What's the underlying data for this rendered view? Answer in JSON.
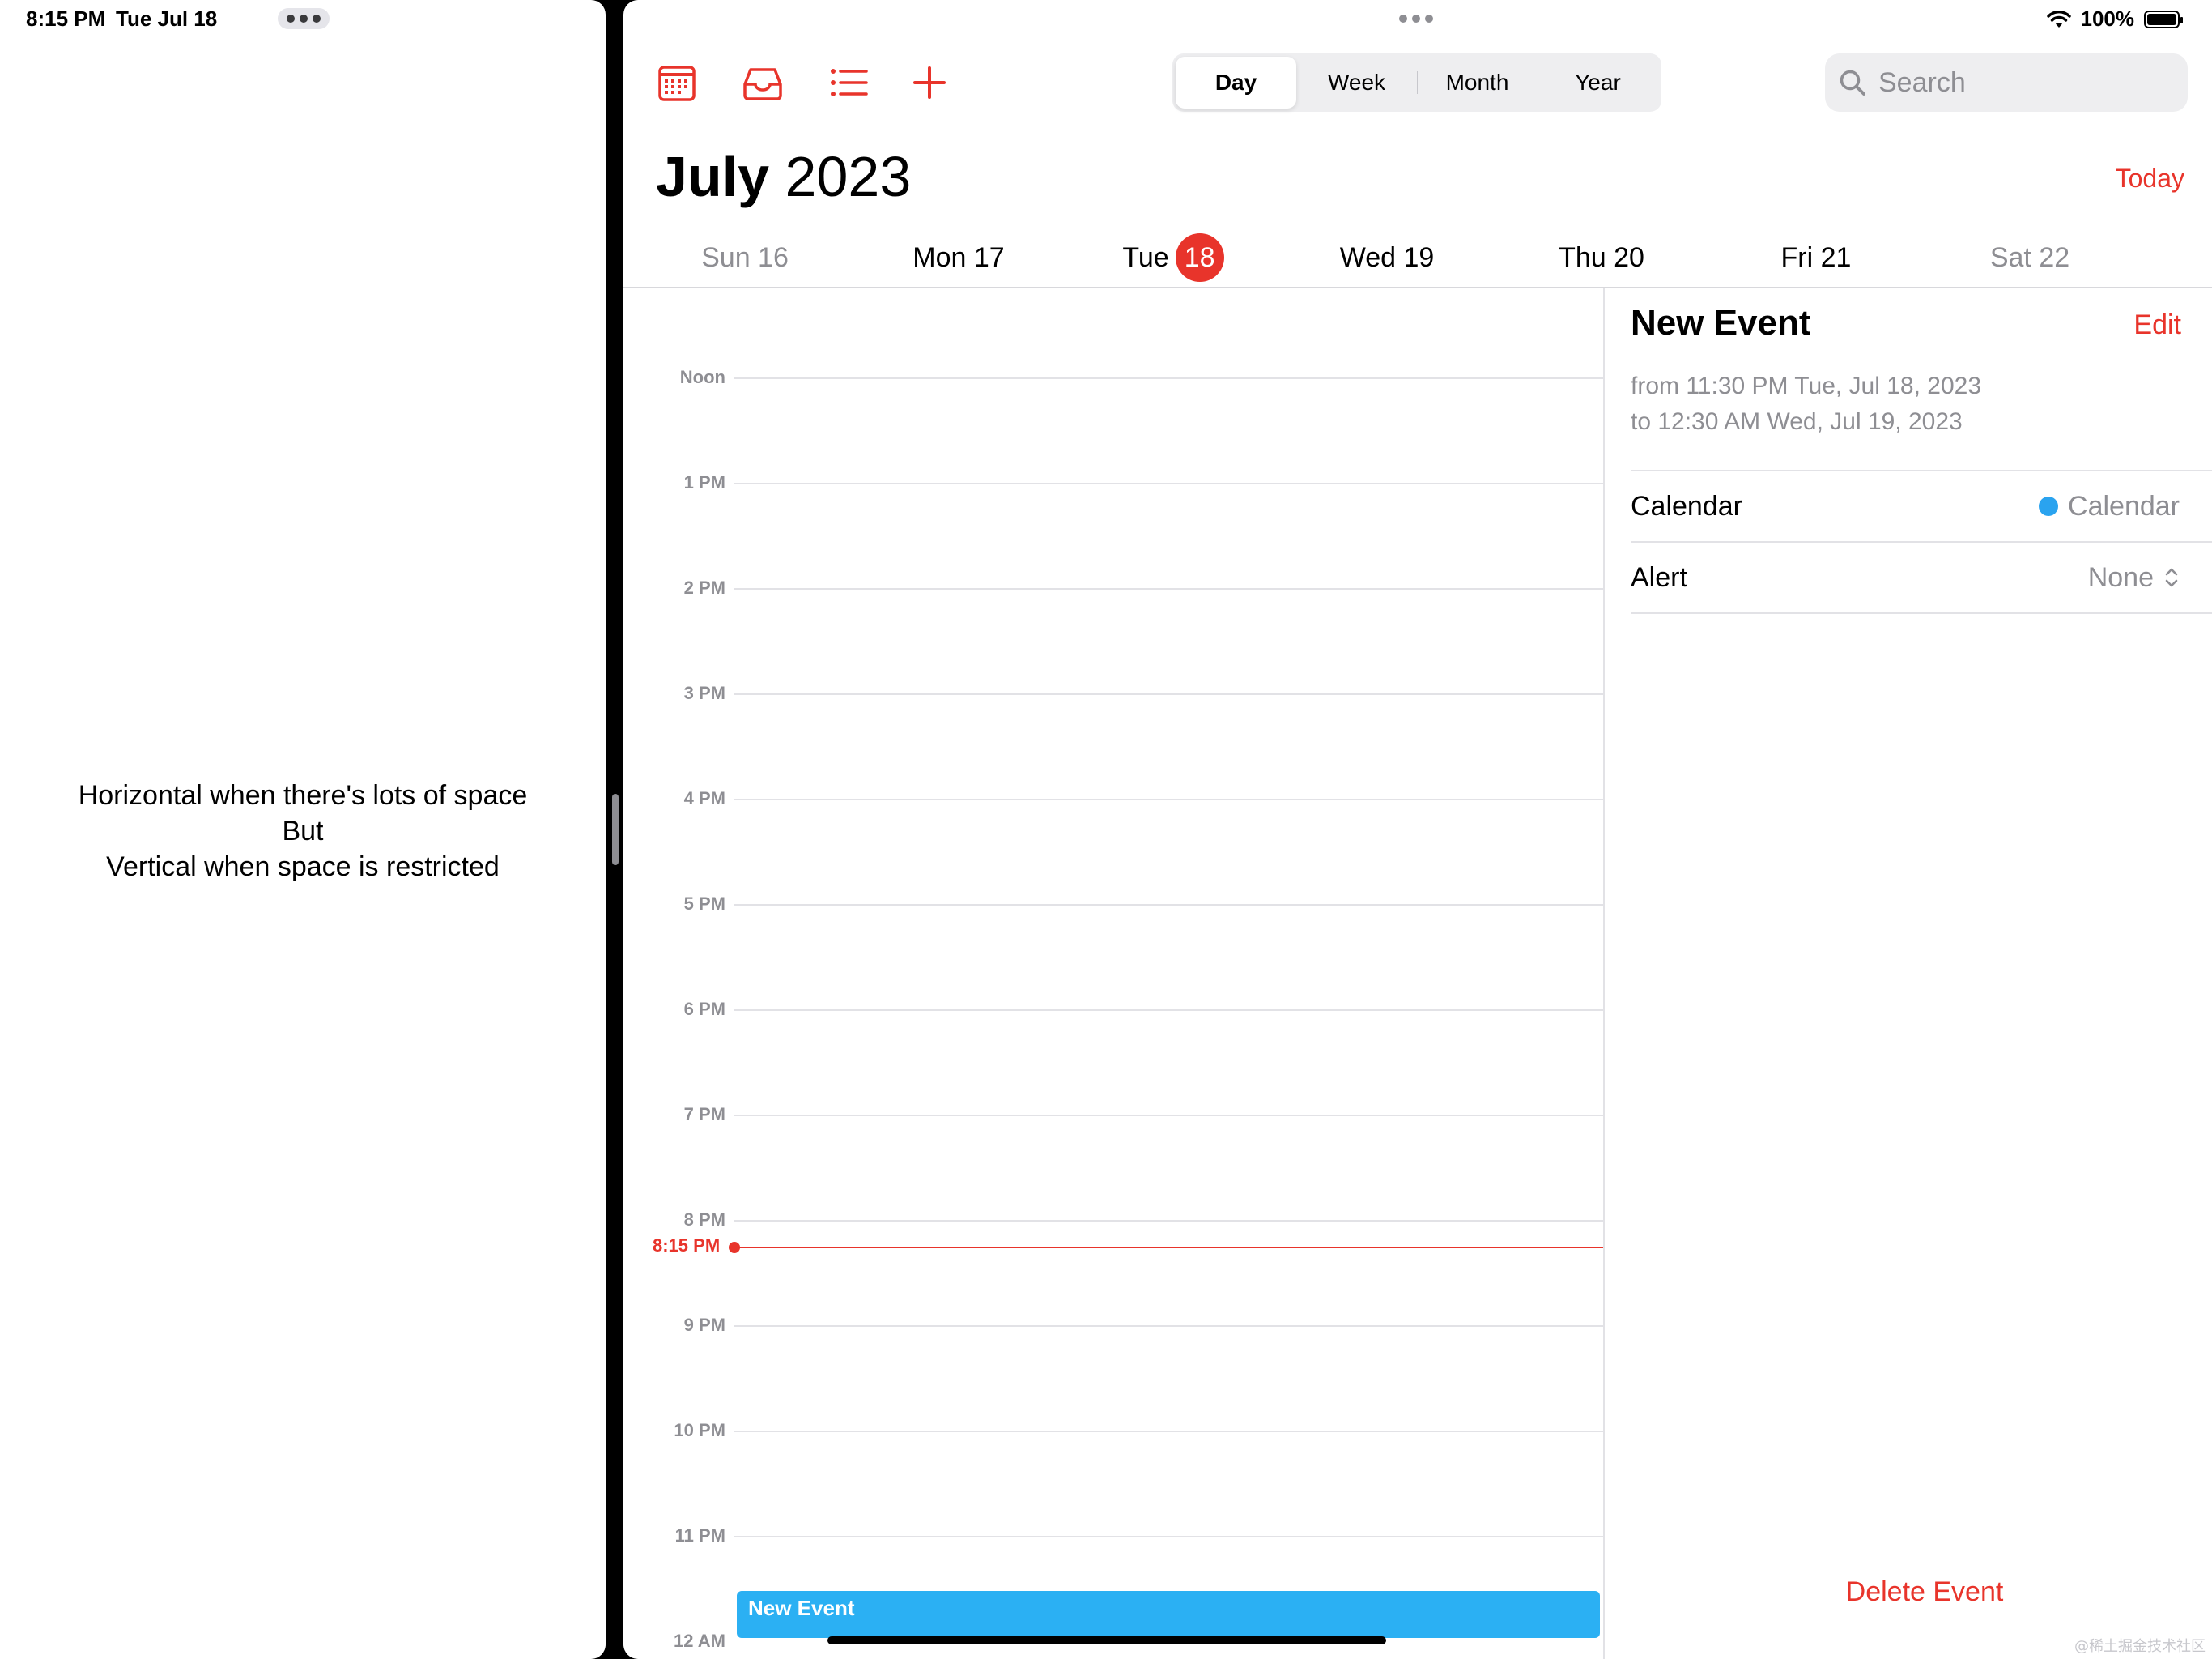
{
  "status_bar": {
    "time": "8:15 PM",
    "date": "Tue Jul 18",
    "battery": "100%"
  },
  "left_pane": {
    "message_lines": [
      "Horizontal when there's lots of space",
      "But",
      "Vertical when space is restricted"
    ]
  },
  "toolbar": {
    "views": [
      "Day",
      "Week",
      "Month",
      "Year"
    ],
    "active_view": "Day",
    "search_placeholder": "Search"
  },
  "header": {
    "month": "July",
    "year": "2023",
    "today_label": "Today"
  },
  "days": [
    {
      "label": "Sun 16",
      "weekend": true
    },
    {
      "label": "Mon 17",
      "weekend": false
    },
    {
      "label": "Tue",
      "number": "18",
      "today": true
    },
    {
      "label": "Wed 19",
      "weekend": false
    },
    {
      "label": "Thu 20",
      "weekend": false
    },
    {
      "label": "Fri 21",
      "weekend": false
    },
    {
      "label": "Sat 22",
      "weekend": true
    }
  ],
  "timeline": {
    "hours": [
      "Noon",
      "1 PM",
      "2 PM",
      "3 PM",
      "4 PM",
      "5 PM",
      "6 PM",
      "7 PM",
      "8 PM",
      "9 PM",
      "10 PM",
      "11 PM",
      "12 AM"
    ],
    "now_label": "8:15 PM",
    "event_title": "New Event"
  },
  "inspector": {
    "title": "New Event",
    "edit_label": "Edit",
    "from_text": "from 11:30 PM Tue, Jul 18, 2023",
    "to_text": "to 12:30 AM Wed, Jul 19, 2023",
    "calendar_label": "Calendar",
    "calendar_value": "Calendar",
    "alert_label": "Alert",
    "alert_value": "None",
    "delete_label": "Delete Event"
  },
  "colors": {
    "accent_red": "#e8342b",
    "event_blue": "#2bb0f3"
  },
  "watermark": "@稀土掘金技术社区"
}
